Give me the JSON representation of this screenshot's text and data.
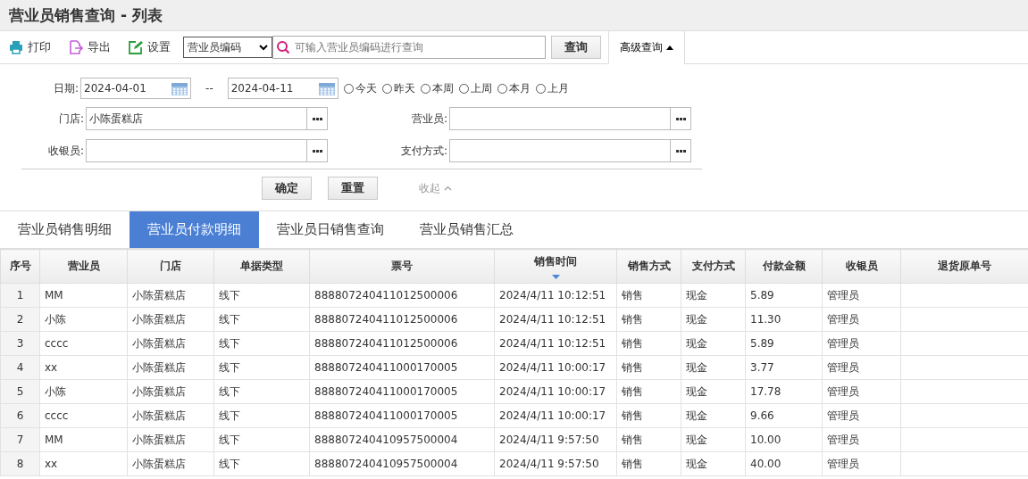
{
  "title": "营业员销售查询 - 列表",
  "toolbar": {
    "actions": [
      {
        "kind": "print",
        "label": "打印"
      },
      {
        "kind": "export",
        "label": "导出"
      },
      {
        "kind": "settings",
        "label": "设置"
      }
    ],
    "search_field_select": "营业员编码",
    "search_placeholder": "可输入营业员编码进行查询",
    "search_button": "查询",
    "advanced_button": {
      "label": "高级查询",
      "expanded": true
    }
  },
  "filters": {
    "date_label": "日期:",
    "date_from": "2024-04-01",
    "date_separator": "--",
    "date_to": "2024-04-11",
    "quick_ranges": [
      {
        "label": "今天",
        "selected": false
      },
      {
        "label": "昨天",
        "selected": false
      },
      {
        "label": "本周",
        "selected": false
      },
      {
        "label": "上周",
        "selected": false
      },
      {
        "label": "本月",
        "selected": false
      },
      {
        "label": "上月",
        "selected": false
      }
    ],
    "fields": [
      {
        "label": "门店:",
        "value": "小陈蛋糕店"
      },
      {
        "label": "营业员:"
      },
      {
        "label": "收银员:"
      },
      {
        "label": "支付方式:"
      }
    ],
    "confirm_button": "确定",
    "reset_button": "重置",
    "collapse_link": "收起"
  },
  "tabs": [
    {
      "label": "营业员销售明细",
      "selected": false
    },
    {
      "label": "营业员付款明细",
      "selected": true
    },
    {
      "label": "营业员日销售查询",
      "selected": false
    },
    {
      "label": "营业员销售汇总",
      "selected": false
    }
  ],
  "table": {
    "columns": [
      {
        "label": "序号",
        "sorted": false
      },
      {
        "label": "营业员",
        "sorted": false
      },
      {
        "label": "门店",
        "sorted": false
      },
      {
        "label": "单据类型",
        "sorted": false
      },
      {
        "label": "票号",
        "sorted": false
      },
      {
        "label": "销售时间",
        "sorted": true
      },
      {
        "label": "销售方式",
        "sorted": false
      },
      {
        "label": "支付方式",
        "sorted": false
      },
      {
        "label": "付款金额",
        "sorted": false
      },
      {
        "label": "收银员",
        "sorted": false
      },
      {
        "label": "退货原单号",
        "sorted": false
      }
    ],
    "rows": [
      [
        "1",
        "MM",
        "小陈蛋糕店",
        "线下",
        "888807240411012500006",
        "2024/4/11 10:12:51",
        "销售",
        "现金",
        "5.89",
        "管理员"
      ],
      [
        "2",
        "小陈",
        "小陈蛋糕店",
        "线下",
        "888807240411012500006",
        "2024/4/11 10:12:51",
        "销售",
        "现金",
        "11.30",
        "管理员"
      ],
      [
        "3",
        "cccc",
        "小陈蛋糕店",
        "线下",
        "888807240411012500006",
        "2024/4/11 10:12:51",
        "销售",
        "现金",
        "5.89",
        "管理员"
      ],
      [
        "4",
        "xx",
        "小陈蛋糕店",
        "线下",
        "888807240411000170005",
        "2024/4/11 10:00:17",
        "销售",
        "现金",
        "3.77",
        "管理员"
      ],
      [
        "5",
        "小陈",
        "小陈蛋糕店",
        "线下",
        "888807240411000170005",
        "2024/4/11 10:00:17",
        "销售",
        "现金",
        "17.78",
        "管理员"
      ],
      [
        "6",
        "cccc",
        "小陈蛋糕店",
        "线下",
        "888807240411000170005",
        "2024/4/11 10:00:17",
        "销售",
        "现金",
        "9.66",
        "管理员"
      ],
      [
        "7",
        "MM",
        "小陈蛋糕店",
        "线下",
        "888807240410957500004",
        "2024/4/11 9:57:50",
        "销售",
        "现金",
        "10.00",
        "管理员"
      ],
      [
        "8",
        "xx",
        "小陈蛋糕店",
        "线下",
        "888807240410957500004",
        "2024/4/11 9:57:50",
        "销售",
        "现金",
        "40.00",
        "管理员"
      ]
    ]
  }
}
